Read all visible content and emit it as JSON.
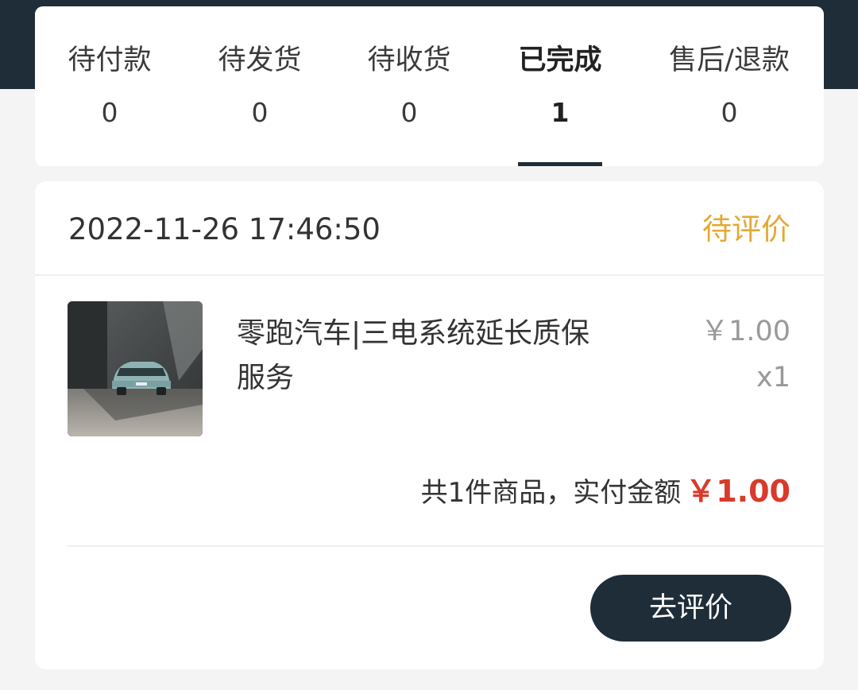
{
  "tabs": [
    {
      "label": "待付款",
      "count": "0"
    },
    {
      "label": "待发货",
      "count": "0"
    },
    {
      "label": "待收货",
      "count": "0"
    },
    {
      "label": "已完成",
      "count": "1"
    },
    {
      "label": "售后/退款",
      "count": "0"
    }
  ],
  "active_tab": "已完成",
  "order": {
    "time": "2022-11-26 17:46:50",
    "status": "待评价",
    "product": {
      "name": "零跑汽车|三电系统延长质保服务",
      "price": "￥1.00",
      "quantity": "x1",
      "image": "car-photo"
    },
    "summary_label": "共1件商品，实付金额",
    "summary_amount": "￥1.00",
    "review_button_label": "去评价"
  },
  "colors": {
    "header_dark": "#1e2d38",
    "status_orange": "#e4a834",
    "price_red": "#d93a2b",
    "background": "#f4f4f4"
  }
}
